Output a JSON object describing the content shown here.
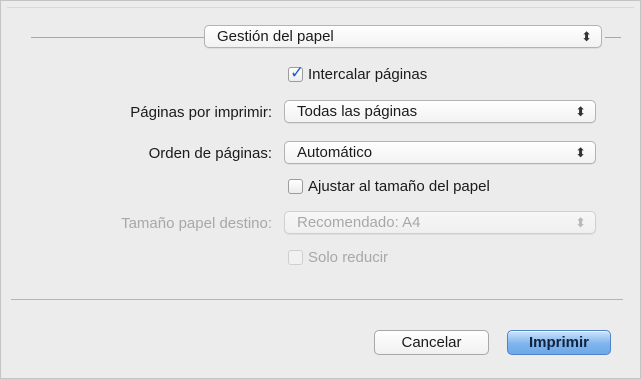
{
  "panel": {
    "selector_value": "Gestión del papel"
  },
  "collate": {
    "label": "Intercalar páginas",
    "checked": true
  },
  "pages_to_print": {
    "label": "Páginas por imprimir:",
    "value": "Todas las páginas"
  },
  "page_order": {
    "label": "Orden de páginas:",
    "value": "Automático"
  },
  "scale_to_fit": {
    "label": "Ajustar al tamaño del papel",
    "checked": false
  },
  "destination_paper": {
    "label": "Tamaño papel destino:",
    "value": "Recomendado: A4",
    "enabled": false
  },
  "scale_down_only": {
    "label": "Solo reducir",
    "checked": false,
    "enabled": false
  },
  "buttons": {
    "cancel": "Cancelar",
    "print": "Imprimir"
  },
  "colors": {
    "accent": "#6ea8e8",
    "check": "#1f5fd0",
    "disabled_text": "#a8a8a8"
  }
}
